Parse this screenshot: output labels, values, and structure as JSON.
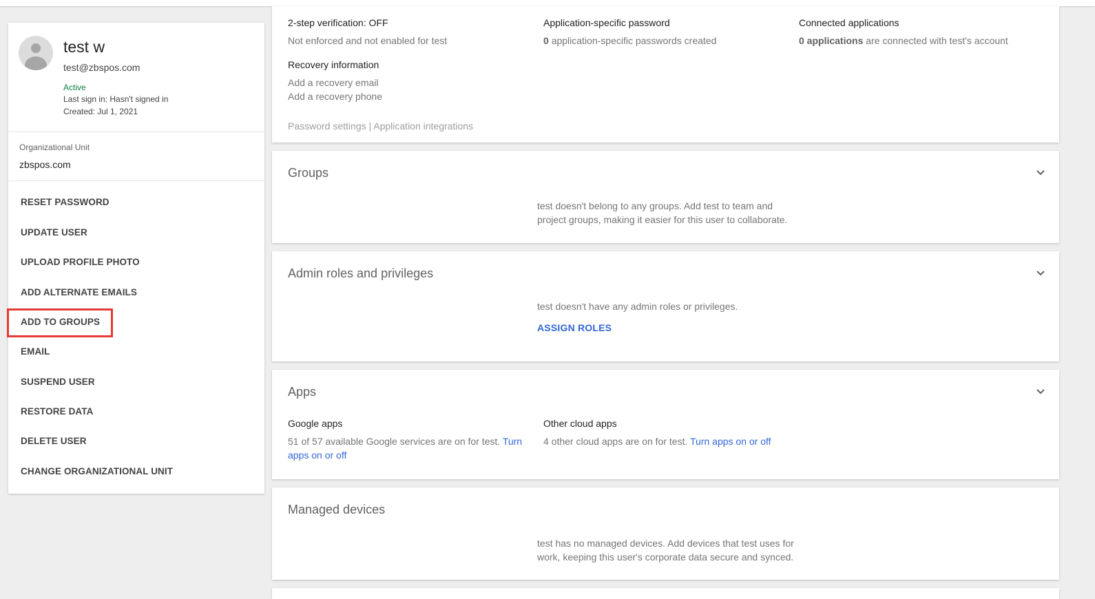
{
  "profile": {
    "name": "test w",
    "email": "test@zbspos.com",
    "status": "Active",
    "last_sign_in": "Last sign in: Hasn't signed in",
    "created": "Created: Jul 1, 2021",
    "org_unit_label": "Organizational Unit",
    "org_unit_value": "zbspos.com"
  },
  "actions": [
    {
      "label": "RESET PASSWORD"
    },
    {
      "label": "UPDATE USER"
    },
    {
      "label": "UPLOAD PROFILE PHOTO"
    },
    {
      "label": "ADD ALTERNATE EMAILS"
    },
    {
      "label": "ADD TO GROUPS"
    },
    {
      "label": "EMAIL"
    },
    {
      "label": "SUSPEND USER"
    },
    {
      "label": "RESTORE DATA"
    },
    {
      "label": "DELETE USER"
    },
    {
      "label": "CHANGE ORGANIZATIONAL UNIT"
    }
  ],
  "security": {
    "two_step_label": "2-step verification:",
    "two_step_value": "OFF",
    "two_step_desc": "Not enforced and not enabled for test",
    "app_password_title": "Application-specific password",
    "app_password_count": "0",
    "app_password_desc": "application-specific passwords created",
    "connected_title": "Connected applications",
    "connected_count": "0 applications",
    "connected_desc": "are connected with test's account",
    "recovery_title": "Recovery information",
    "recovery_email": "Add a recovery email",
    "recovery_phone": "Add a recovery phone",
    "password_settings": "Password settings",
    "separator": "|",
    "app_integrations": "Application integrations"
  },
  "groups": {
    "title": "Groups",
    "message_line1": "test doesn't belong to any groups. Add test to team and",
    "message_line2": "project groups, making it easier for this user to collaborate."
  },
  "admin": {
    "title": "Admin roles and privileges",
    "message": "test doesn't have any admin roles or privileges.",
    "assign_label": "ASSIGN ROLES"
  },
  "apps": {
    "title": "Apps",
    "google_title": "Google apps",
    "google_desc": "51 of 57 available Google services are on for test.",
    "google_link_1": "Turn",
    "google_link_2": "apps on or off",
    "other_title": "Other cloud apps",
    "other_desc": "4 other cloud apps are on for test.",
    "other_link": "Turn apps on or off"
  },
  "devices": {
    "title": "Managed devices",
    "message_line1": "test has no managed devices. Add devices that test uses for",
    "message_line2": "work, keeping this user's corporate data secure and synced."
  },
  "colors": {
    "accent_link": "#3367d6",
    "active_green": "#0b8043",
    "highlight_red": "#e53935"
  }
}
